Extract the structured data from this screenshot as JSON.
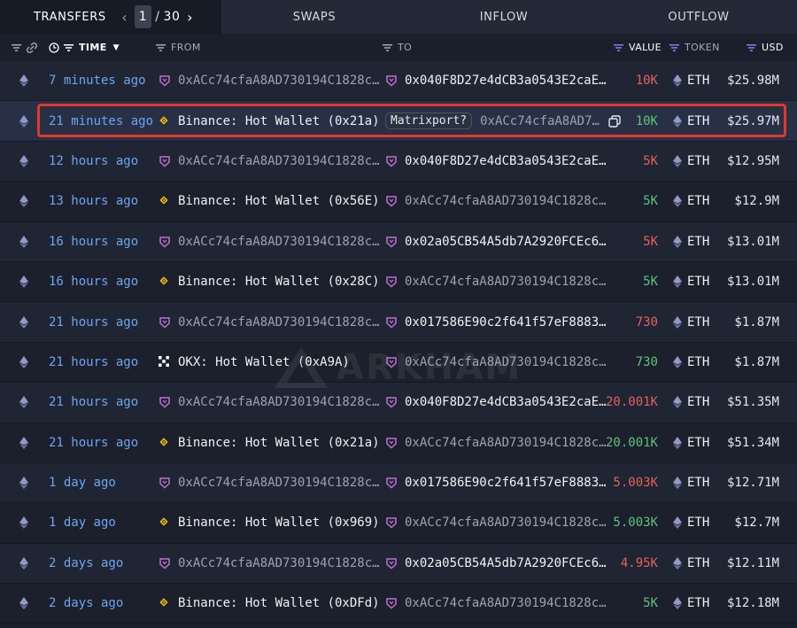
{
  "tabs": {
    "transfers": "TRANSFERS",
    "swaps": "SWAPS",
    "inflow": "INFLOW",
    "outflow": "OUTFLOW",
    "page_current": "1",
    "page_sep": "/",
    "page_total": "30"
  },
  "headers": {
    "time": "TIME",
    "from": "FROM",
    "to": "TO",
    "value": "VALUE",
    "token": "TOKEN",
    "usd": "USD"
  },
  "watermark": "ARKHAM",
  "colors": {
    "link_blue": "#6ea5f2",
    "value_red": "#e5605a",
    "value_green": "#5fc27a",
    "highlight_red": "#e0392b",
    "binance_yellow": "#f0b90b",
    "contract_purple": "#c06fd0"
  },
  "rows": [
    {
      "time": "7 minutes ago",
      "from_icon": "contract-icon",
      "from": "0xACc74cfaA8AD730194C1828c…",
      "to_icon": "contract-icon",
      "to": "0x040F8D27e4dCB3a0543E2caE…",
      "to_tag": "",
      "value": "10K",
      "value_color": "red",
      "token": "ETH",
      "usd": "$25.98M"
    },
    {
      "time": "21 minutes ago",
      "from_icon": "binance-icon",
      "from": "Binance: Hot Wallet (0x21a)",
      "to_icon": "",
      "to": "0xACc74cfaA8AD7…",
      "to_tag": "Matrixport?",
      "value": "10K",
      "value_color": "green",
      "token": "ETH",
      "usd": "$25.97M"
    },
    {
      "time": "12 hours ago",
      "from_icon": "contract-icon",
      "from": "0xACc74cfaA8AD730194C1828c…",
      "to_icon": "contract-icon",
      "to": "0x040F8D27e4dCB3a0543E2caE…",
      "to_tag": "",
      "value": "5K",
      "value_color": "red",
      "token": "ETH",
      "usd": "$12.95M"
    },
    {
      "time": "13 hours ago",
      "from_icon": "binance-icon",
      "from": "Binance: Hot Wallet (0x56E)",
      "to_icon": "contract-icon",
      "to": "0xACc74cfaA8AD730194C1828c…",
      "to_tag": "",
      "value": "5K",
      "value_color": "green",
      "token": "ETH",
      "usd": "$12.9M"
    },
    {
      "time": "16 hours ago",
      "from_icon": "contract-icon",
      "from": "0xACc74cfaA8AD730194C1828c…",
      "to_icon": "contract-icon",
      "to": "0x02a05CB54A5db7A2920FCEc6…",
      "to_tag": "",
      "value": "5K",
      "value_color": "red",
      "token": "ETH",
      "usd": "$13.01M"
    },
    {
      "time": "16 hours ago",
      "from_icon": "binance-icon",
      "from": "Binance: Hot Wallet (0x28C)",
      "to_icon": "contract-icon",
      "to": "0xACc74cfaA8AD730194C1828c…",
      "to_tag": "",
      "value": "5K",
      "value_color": "green",
      "token": "ETH",
      "usd": "$13.01M"
    },
    {
      "time": "21 hours ago",
      "from_icon": "contract-icon",
      "from": "0xACc74cfaA8AD730194C1828c…",
      "to_icon": "contract-icon",
      "to": "0x017586E90c2f641f57eF8883…",
      "to_tag": "",
      "value": "730",
      "value_color": "red",
      "token": "ETH",
      "usd": "$1.87M"
    },
    {
      "time": "21 hours ago",
      "from_icon": "okx-icon",
      "from": "OKX: Hot Wallet (0xA9A)",
      "to_icon": "contract-icon",
      "to": "0xACc74cfaA8AD730194C1828c…",
      "to_tag": "",
      "value": "730",
      "value_color": "green",
      "token": "ETH",
      "usd": "$1.87M"
    },
    {
      "time": "21 hours ago",
      "from_icon": "contract-icon",
      "from": "0xACc74cfaA8AD730194C1828c…",
      "to_icon": "contract-icon",
      "to": "0x040F8D27e4dCB3a0543E2caE…",
      "to_tag": "",
      "value": "20.001K",
      "value_color": "red",
      "token": "ETH",
      "usd": "$51.35M"
    },
    {
      "time": "21 hours ago",
      "from_icon": "binance-icon",
      "from": "Binance: Hot Wallet (0x21a)",
      "to_icon": "contract-icon",
      "to": "0xACc74cfaA8AD730194C1828c…",
      "to_tag": "",
      "value": "20.001K",
      "value_color": "green",
      "token": "ETH",
      "usd": "$51.34M"
    },
    {
      "time": "1 day ago",
      "from_icon": "contract-icon",
      "from": "0xACc74cfaA8AD730194C1828c…",
      "to_icon": "contract-icon",
      "to": "0x017586E90c2f641f57eF8883…",
      "to_tag": "",
      "value": "5.003K",
      "value_color": "red",
      "token": "ETH",
      "usd": "$12.71M"
    },
    {
      "time": "1 day ago",
      "from_icon": "binance-icon",
      "from": "Binance: Hot Wallet (0x969)",
      "to_icon": "contract-icon",
      "to": "0xACc74cfaA8AD730194C1828c…",
      "to_tag": "",
      "value": "5.003K",
      "value_color": "green",
      "token": "ETH",
      "usd": "$12.7M"
    },
    {
      "time": "2 days ago",
      "from_icon": "contract-icon",
      "from": "0xACc74cfaA8AD730194C1828c…",
      "to_icon": "contract-icon",
      "to": "0x02a05CB54A5db7A2920FCEc6…",
      "to_tag": "",
      "value": "4.95K",
      "value_color": "red",
      "token": "ETH",
      "usd": "$12.11M"
    },
    {
      "time": "2 days ago",
      "from_icon": "binance-icon",
      "from": "Binance: Hot Wallet (0xDFd)",
      "to_icon": "contract-icon",
      "to": "0xACc74cfaA8AD730194C1828c…",
      "to_tag": "",
      "value": "5K",
      "value_color": "green",
      "token": "ETH",
      "usd": "$12.18M"
    }
  ]
}
